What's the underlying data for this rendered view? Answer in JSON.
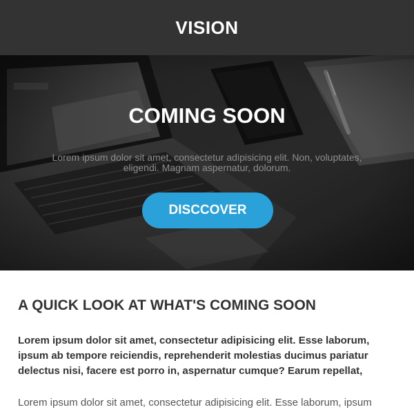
{
  "header": {
    "brand": "VISION"
  },
  "hero": {
    "title": "COMING SOON",
    "text": "Lorem ipsum dolor sit amet, consectetur adipisicing elit. Non, voluptates, eligendi. Magnam aspernatur, dolorum.",
    "cta_label": "DISCCOVER"
  },
  "section": {
    "title": "A QUICK LOOK AT WHAT'S COMING SOON",
    "bold_paragraph": "Lorem ipsum dolor sit amet, consectetur adipisicing elit. Esse laborum, ipsum ab tempore reiciendis, reprehenderit molestias ducimus pariatur delectus nisi, facere est porro in, aspernatur cumque? Earum repellat,",
    "paragraph": "Lorem ipsum dolor sit amet, consectetur adipisicing elit. Esse laborum, ipsum"
  },
  "colors": {
    "header_bg": "#333333",
    "accent": "#2aa1d9",
    "heading_text": "#333333"
  }
}
